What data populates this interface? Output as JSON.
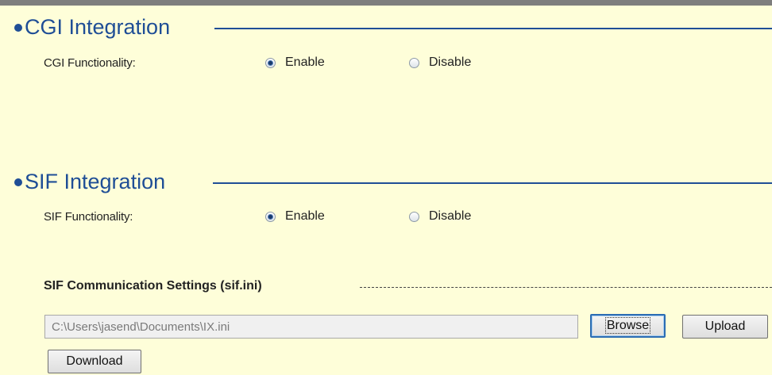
{
  "cgi": {
    "title": "CGI Integration",
    "field_label": "CGI Functionality:",
    "enable_label": "Enable",
    "disable_label": "Disable",
    "selected": "Enable"
  },
  "sif": {
    "title": "SIF Integration",
    "field_label": "SIF Functionality:",
    "enable_label": "Enable",
    "disable_label": "Disable",
    "selected": "Enable",
    "comm_settings": {
      "title": "SIF Communication Settings (sif.ini)",
      "file_path": "C:\\Users\\jasend\\Documents\\IX.ini",
      "browse_label": "Browse",
      "upload_label": "Upload",
      "download_label": "Download"
    }
  },
  "colors": {
    "background": "#fefed9",
    "section_title": "#1f4e96",
    "top_border": "#7e7e7e"
  }
}
